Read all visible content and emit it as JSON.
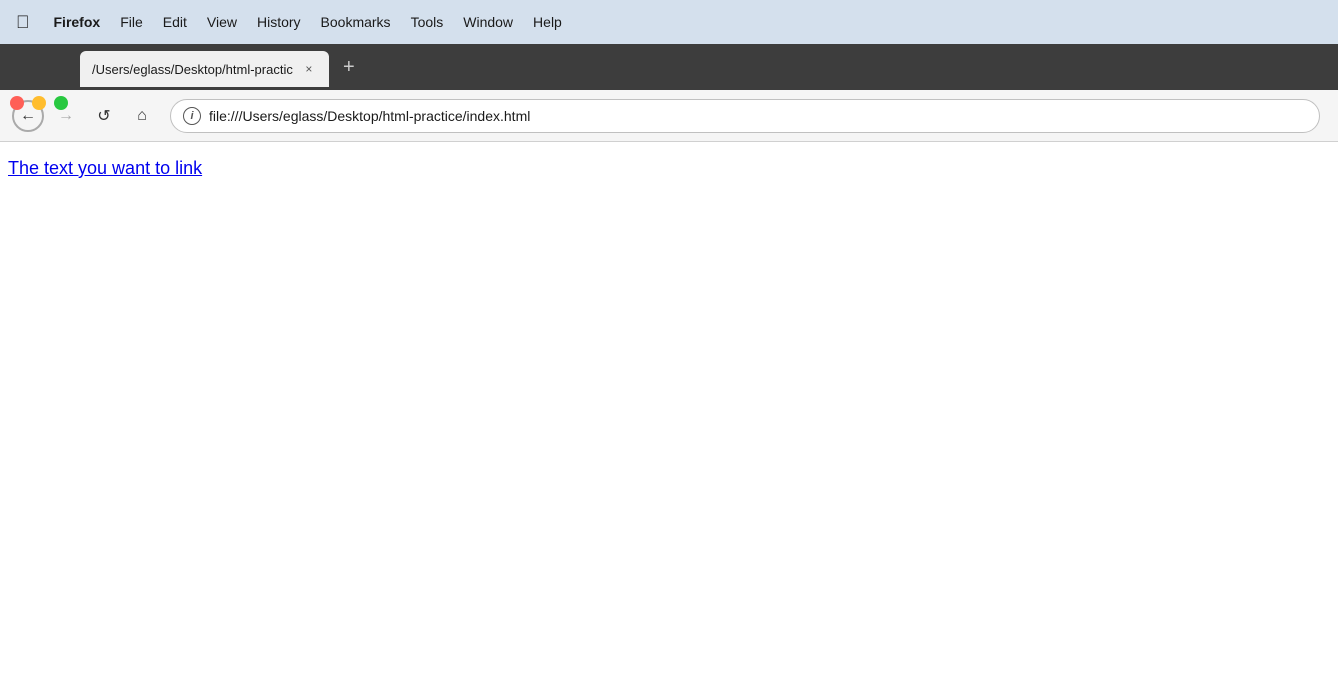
{
  "menubar": {
    "apple": "&#63743;",
    "items": [
      {
        "label": "Firefox",
        "bold": true
      },
      {
        "label": "File"
      },
      {
        "label": "Edit"
      },
      {
        "label": "View"
      },
      {
        "label": "History"
      },
      {
        "label": "Bookmarks"
      },
      {
        "label": "Tools"
      },
      {
        "label": "Window"
      },
      {
        "label": "Help"
      }
    ]
  },
  "tab": {
    "title": "/Users/eglass/Desktop/html-practic",
    "close_label": "×"
  },
  "new_tab": {
    "label": "+"
  },
  "address_bar": {
    "url": "file:///Users/eglass/Desktop/html-practice/index.html",
    "info_icon": "i"
  },
  "page": {
    "link_text": "The text you want to link"
  },
  "nav": {
    "back": "←",
    "forward": "→",
    "reload": "↺",
    "home": "⌂"
  },
  "traffic_lights": {
    "red": "#ff5f57",
    "yellow": "#ffbd2e",
    "green": "#28c840"
  }
}
